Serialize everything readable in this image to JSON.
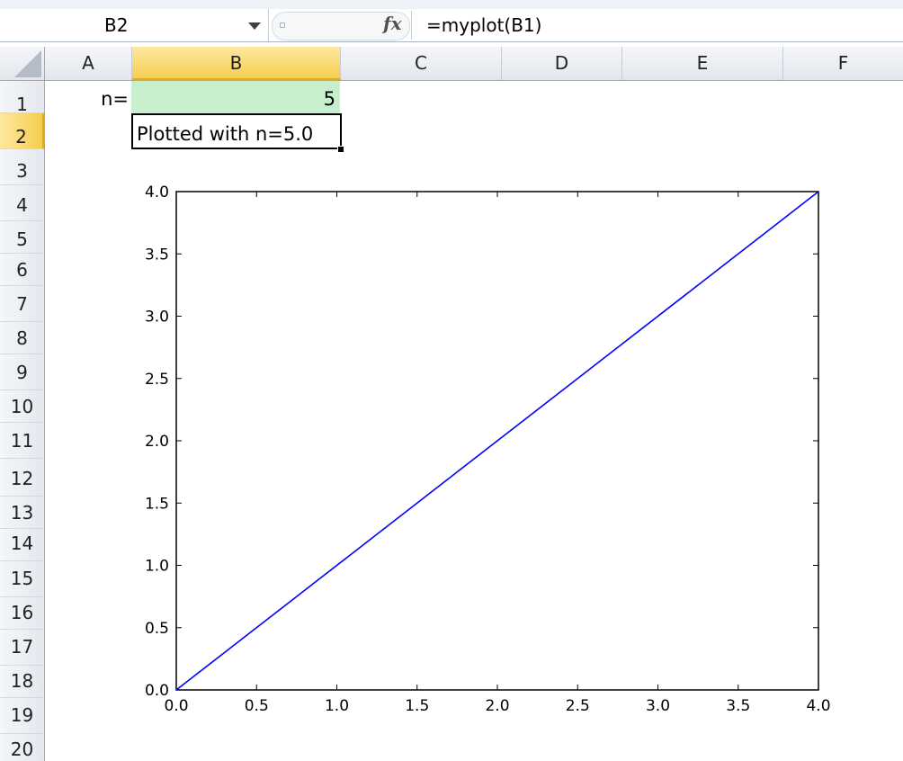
{
  "formula_bar": {
    "name_box": "B2",
    "fx_symbol": "fx",
    "formula": "=myplot(B1)"
  },
  "columns": [
    "A",
    "B",
    "C",
    "D",
    "E",
    "F"
  ],
  "active_column": "B",
  "rows": [
    "1",
    "2",
    "3",
    "4",
    "5",
    "6",
    "7",
    "8",
    "9",
    "10",
    "11",
    "12",
    "13",
    "14",
    "15",
    "16",
    "17",
    "18",
    "19",
    "20"
  ],
  "active_row": "2",
  "cells": {
    "A1": "n=",
    "B1": "5",
    "B2": "Plotted with n=5.0"
  },
  "colors": {
    "b1_fill": "#c6efce",
    "header_highlight": "#f5cd4f",
    "line_color": "#0000ff"
  },
  "chart_data": {
    "type": "line",
    "title": "",
    "xlabel": "",
    "ylabel": "",
    "xlim": [
      0.0,
      4.0
    ],
    "ylim": [
      0.0,
      4.0
    ],
    "grid": false,
    "x_tick_labels": [
      "0.0",
      "0.5",
      "1.0",
      "1.5",
      "2.0",
      "2.5",
      "3.0",
      "3.5",
      "4.0"
    ],
    "y_tick_labels": [
      "0.0",
      "0.5",
      "1.0",
      "1.5",
      "2.0",
      "2.5",
      "3.0",
      "3.5",
      "4.0"
    ],
    "series": [
      {
        "x": [
          0.0,
          4.0
        ],
        "y": [
          0.0,
          4.0
        ],
        "color": "#0000ff"
      }
    ]
  }
}
